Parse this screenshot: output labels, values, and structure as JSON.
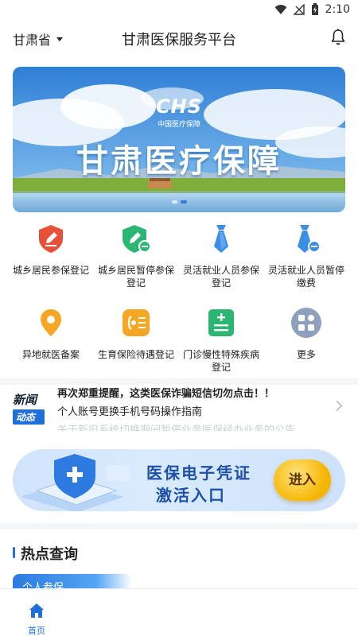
{
  "status_bar": {
    "time": "2:10"
  },
  "header": {
    "province": "甘肃省",
    "title": "甘肃医保服务平台"
  },
  "banner": {
    "logo_mark": "CHS",
    "logo_sub": "中国医疗保障",
    "title": "甘肃医疗保障"
  },
  "grid": [
    {
      "label": "城乡居民参保登记",
      "icon": "shield-pen-icon"
    },
    {
      "label": "城乡居民暂停参保登记",
      "icon": "shield-pen-minus-icon"
    },
    {
      "label": "灵活就业人员参保登记",
      "icon": "tie-icon"
    },
    {
      "label": "灵活就业人员暂停缴费",
      "icon": "tie-minus-icon"
    },
    {
      "label": "异地就医备案",
      "icon": "location-pin-icon"
    },
    {
      "label": "生育保险待遇登记",
      "icon": "maternity-icon"
    },
    {
      "label": "门诊慢性特殊疾病登记",
      "icon": "clinic-icon"
    },
    {
      "label": "更多",
      "icon": "more-icon"
    }
  ],
  "news": {
    "badge_top": "新闻",
    "badge_bottom": "动态",
    "items": [
      "再次郑重提醒，这类医保诈骗短信切勿点击！！",
      "个人账号更换手机号码操作指南",
      "关于新旧系统切换期间暂停业务医保经办业务的公告"
    ]
  },
  "promo": {
    "title": "医保电子凭证",
    "subtitle": "激活入口",
    "button": "进入"
  },
  "hot": {
    "title": "热点查询",
    "tab": "个人参保"
  },
  "bottom_nav": {
    "home": "首页"
  },
  "colors": {
    "primary": "#1e6fd9",
    "red": "#e8503a",
    "green": "#2bb673",
    "blue": "#3a8ee6",
    "orange": "#f5a623"
  }
}
